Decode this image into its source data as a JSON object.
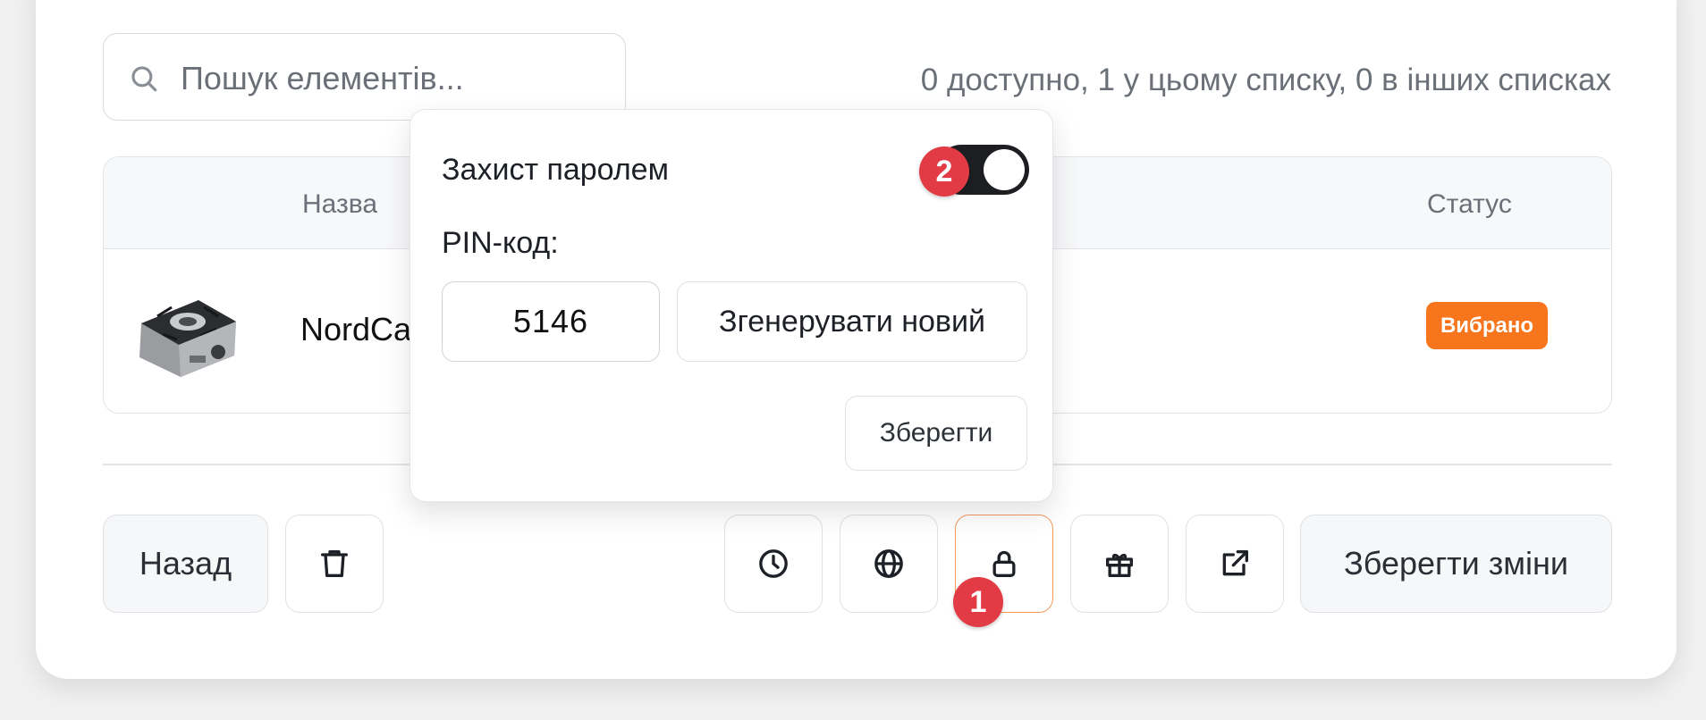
{
  "search": {
    "placeholder": "Пошук елементів..."
  },
  "summary": "0 доступно, 1 у цьому списку, 0 в інших списках",
  "table": {
    "columns": [
      "Назва",
      "Статус"
    ],
    "rows": [
      {
        "name": "NordCa",
        "status": "Вибрано"
      }
    ]
  },
  "colors": {
    "status_badge": "#f7751c",
    "marker": "#e23b46",
    "active_border": "#f39a5a"
  },
  "footer": {
    "back_label": "Назад",
    "save_changes_label": "Зберегти зміни",
    "icons": [
      "trash-icon",
      "clock-icon",
      "globe-icon",
      "lock-icon",
      "gift-icon",
      "external-link-icon"
    ]
  },
  "popover": {
    "title": "Захист паролем",
    "toggle_on": true,
    "pin_label": "PIN-код:",
    "pin_value": "5146",
    "generate_label": "Згенерувати новий",
    "save_label": "Зберегти"
  },
  "markers": [
    "1",
    "2"
  ]
}
